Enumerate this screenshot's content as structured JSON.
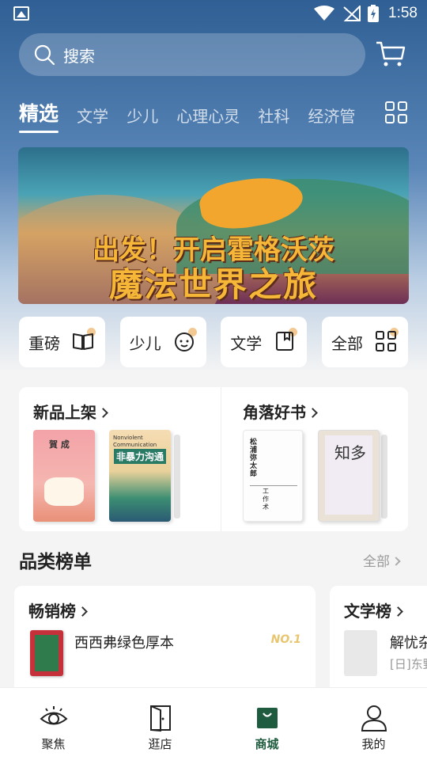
{
  "status_bar": {
    "time": "1:58"
  },
  "search": {
    "placeholder": "搜索"
  },
  "tabs": [
    "精选",
    "文学",
    "少儿",
    "心理心灵",
    "社科",
    "经济管"
  ],
  "banner": {
    "line1": "出发！开启霍格沃茨",
    "line2": "魔法世界之旅"
  },
  "quick_categories": [
    {
      "label": "重磅",
      "icon": "book-open-icon"
    },
    {
      "label": "少儿",
      "icon": "child-face-icon"
    },
    {
      "label": "文学",
      "icon": "bookmark-book-icon"
    },
    {
      "label": "全部",
      "icon": "grid-icon"
    }
  ],
  "new_arrivals": {
    "title": "新品上架",
    "books": [
      {
        "cover_text": "賀 成"
      },
      {
        "cover_small": "Nonviolent Communication",
        "cover_text": "非暴力沟通"
      }
    ]
  },
  "corner_picks": {
    "title": "角落好书",
    "books": [
      {
        "cover_text": "松浦弥太郎",
        "cover_sub": "工作术"
      },
      {
        "cover_text": "知多"
      }
    ]
  },
  "rankings": {
    "title": "品类榜单",
    "all_label": "全部",
    "boards": [
      {
        "name": "畅销榜",
        "top_book": "西西弗绿色厚本",
        "rank_badge": "NO.1"
      },
      {
        "name": "文学榜",
        "top_book": "解忧杂",
        "author": "[日]东野"
      }
    ]
  },
  "bottom_nav": [
    {
      "label": "聚焦",
      "icon": "eye-icon"
    },
    {
      "label": "逛店",
      "icon": "store-door-icon"
    },
    {
      "label": "商城",
      "icon": "shopping-bag-icon",
      "active": true
    },
    {
      "label": "我的",
      "icon": "user-icon"
    }
  ],
  "colors": {
    "accent": "#1f5c3f",
    "header_top": "#2f5f94",
    "badge_gold": "#e8c56f"
  }
}
